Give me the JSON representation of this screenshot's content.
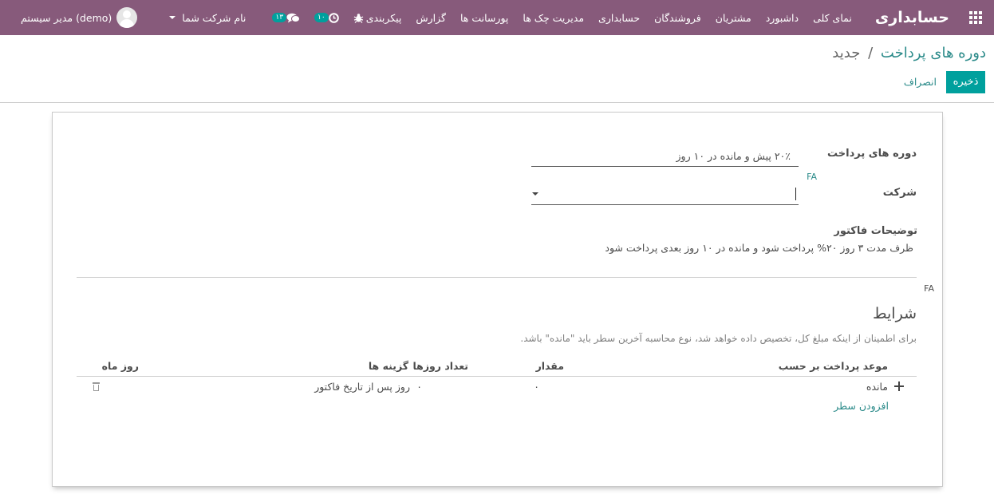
{
  "navbar": {
    "brand": "حسابداری",
    "menu": [
      {
        "label": "نمای کلی"
      },
      {
        "label": "داشبورد"
      },
      {
        "label": "مشتریان"
      },
      {
        "label": "فروشندگان"
      },
      {
        "label": "حسابداری"
      },
      {
        "label": "مدیریت چک ها"
      },
      {
        "label": "پورسانت ها"
      },
      {
        "label": "گزارش"
      },
      {
        "label": "پیکربندی"
      }
    ],
    "activity_count": "۱۰",
    "messages_count": "۱۳",
    "company_switcher": "نام شرکت شما",
    "user_name": "مدیر سیستم (demo)"
  },
  "breadcrumb": {
    "parent": "دوره های پرداخت",
    "separator": "/",
    "current": "جدید"
  },
  "buttons": {
    "save": "ذخیره",
    "discard": "انصراف"
  },
  "form": {
    "payment_term_label": "دوره های پرداخت",
    "payment_term_value": "۲۰٪ پیش و مانده در ۱۰ روز",
    "lang_tag": "FA",
    "company_label": "شرکت",
    "company_value": "",
    "invoice_note_label": "توضیحات فاکتور",
    "invoice_note_value": "ظرف مدت ۳ روز ۲۰% پرداخت شود و مانده در ۱۰ روز بعدی پرداخت شود",
    "lang_tag_2": "FA"
  },
  "terms": {
    "title": "شرایط",
    "help": "برای اطمینان از اینکه مبلغ کل، تخصیص داده خواهد شد، نوع محاسبه آخرین سطر باید \"مانده\" باشد.",
    "columns": {
      "due_type": "موعد پرداخت بر حسب",
      "value": "مقدار",
      "days": "تعداد روزها",
      "option": "گزینه ها",
      "day_of_month": "روز ماه"
    },
    "rows": [
      {
        "due_type": "مانده",
        "value": "۰",
        "days": "۰",
        "option": "روز پس از تاریخ فاکتور",
        "day_of_month": ""
      }
    ],
    "add_line": "افزودن سطر"
  }
}
